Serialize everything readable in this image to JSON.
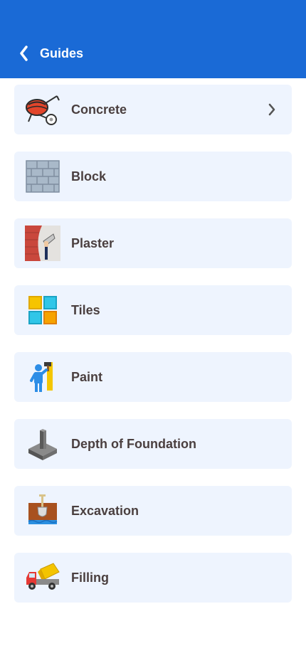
{
  "header": {
    "title": "Guides",
    "background": "#1a6ad6",
    "back_icon": "chevron-left-icon"
  },
  "items": [
    {
      "label": "Concrete",
      "icon": "concrete-mixer-icon",
      "has_chevron": true
    },
    {
      "label": "Block",
      "icon": "brick-block-icon"
    },
    {
      "label": "Plaster",
      "icon": "plaster-trowel-icon"
    },
    {
      "label": "Tiles",
      "icon": "tiles-icon"
    },
    {
      "label": "Paint",
      "icon": "painter-icon"
    },
    {
      "label": "Depth of Foundation",
      "icon": "foundation-icon"
    },
    {
      "label": "Excavation",
      "icon": "excavation-shovel-icon"
    },
    {
      "label": "Filling",
      "icon": "dump-truck-icon"
    }
  ],
  "card_background": "#eef4fe",
  "label_color": "#4a3f3f"
}
